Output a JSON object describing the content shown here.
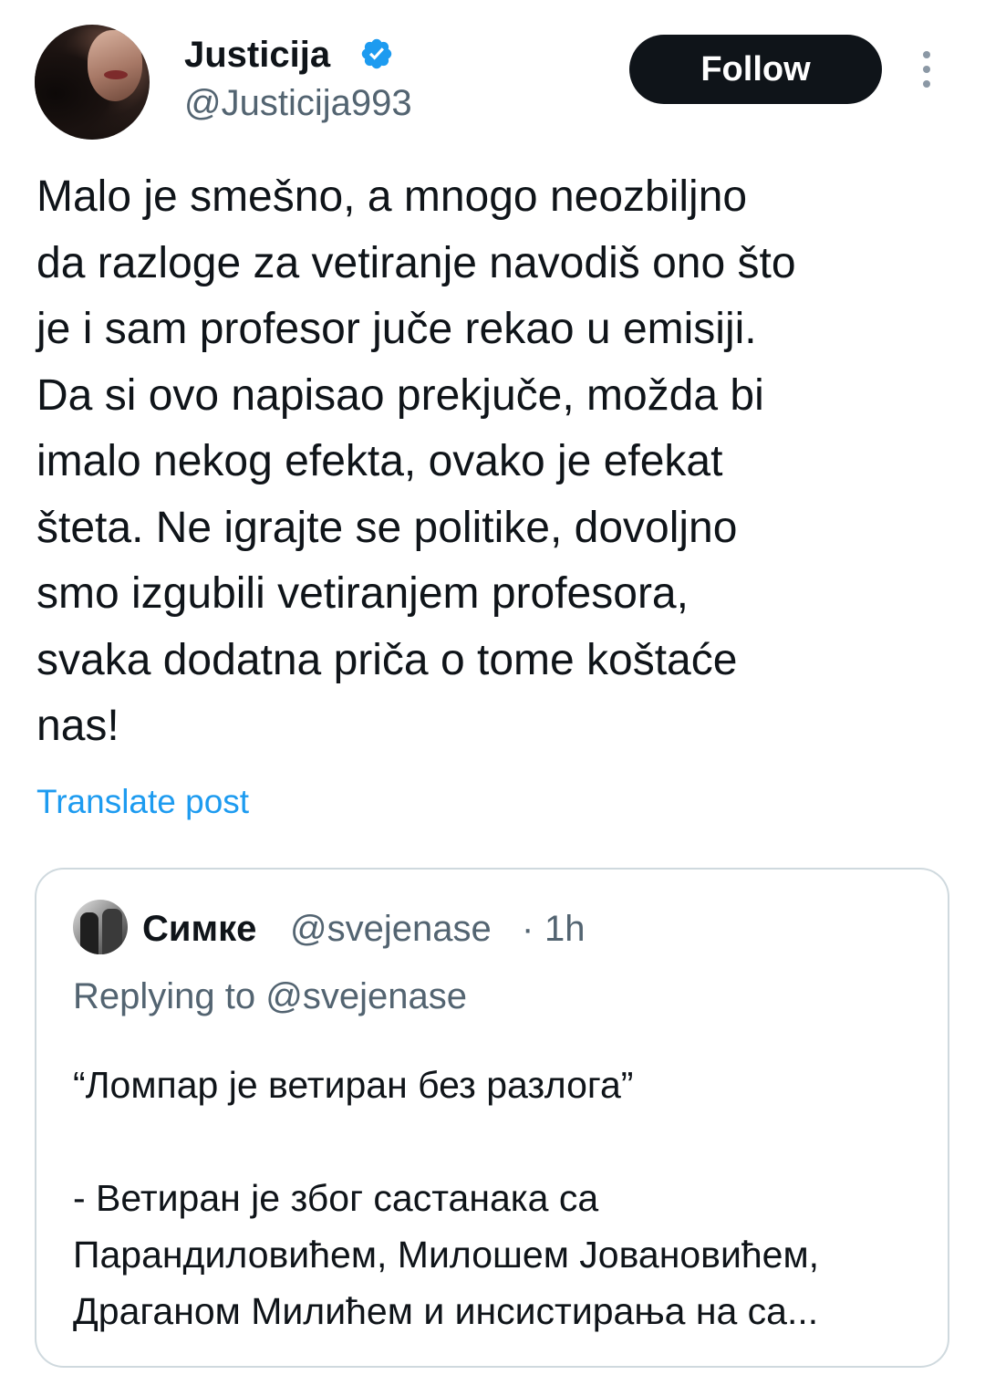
{
  "author": {
    "display_name": "Justicija",
    "handle": "@Justicija993",
    "verified": true
  },
  "actions": {
    "follow_label": "Follow"
  },
  "tweet": {
    "text": "Malo je smešno, a mnogo neozbiljno\nda razloge za vetiranje navodiš ono što\nje i sam profesor juče rekao u emisiji.\nDa si ovo napisao prekjuče, možda bi\nimalo nekog efekta, ovako je efekat\nšteta. Ne igrajte se politike, dovoljno\nsmo izgubili vetiranjem profesora,\nsvaka dodatna priča o tome koštaće\nnas!",
    "translate_label": "Translate post"
  },
  "quoted_tweet": {
    "display_name": "Симке",
    "handle": "@svejenase",
    "separator": "·",
    "time": "1h",
    "replying_to": "Replying to @svejenase",
    "text": "“Ломпар је ветиран без разлога”\n\n- Ветиран је због састанака са\nПарандиловићем, Милошем Јовановићем,\nДраганом Милићем и инсистирања на са..."
  },
  "colors": {
    "text_primary": "#0f1419",
    "text_secondary": "#536471",
    "link": "#1d9bf0",
    "verified_badge": "#1d9bf0",
    "follow_button_bg": "#0f1419",
    "border": "#cfd9de"
  },
  "icons": {
    "verified": "verified-badge-icon",
    "more": "more-vertical-icon"
  }
}
